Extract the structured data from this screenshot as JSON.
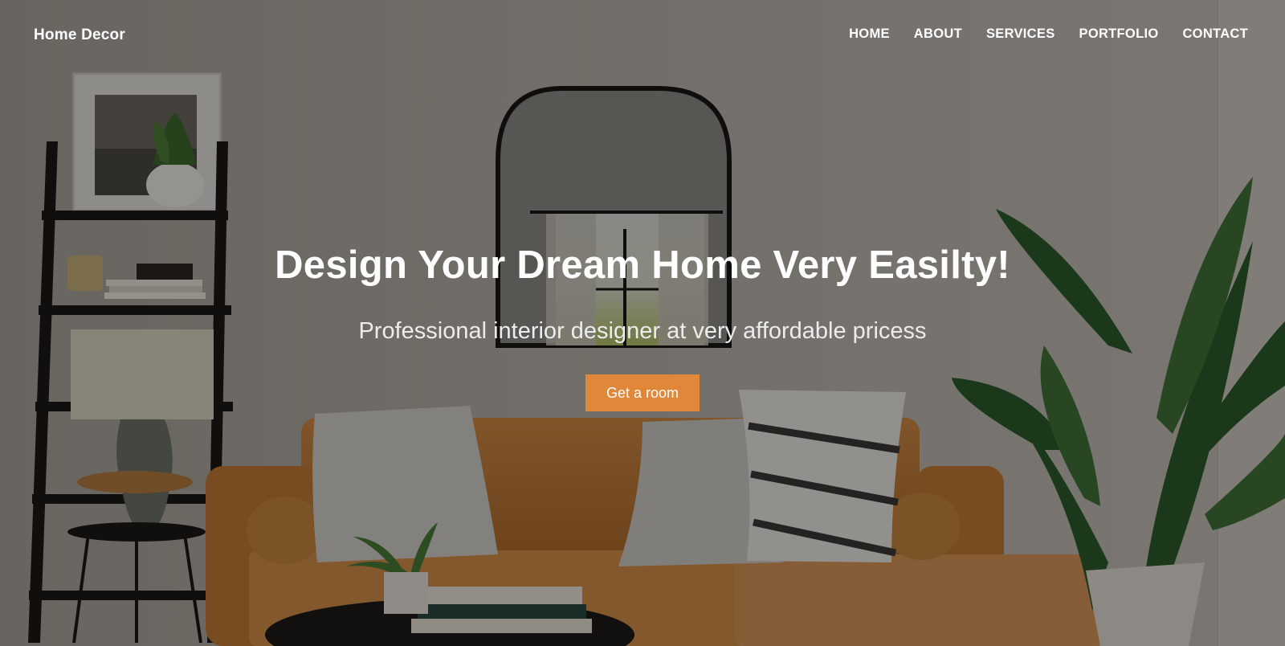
{
  "brand": {
    "name": "Home Decor"
  },
  "nav": {
    "items": [
      {
        "label": "HOME"
      },
      {
        "label": "ABOUT"
      },
      {
        "label": "SERVICES"
      },
      {
        "label": "PORTFOLIO"
      },
      {
        "label": "CONTACT"
      }
    ]
  },
  "hero": {
    "title": "Design Your Dream Home Very Easilty!",
    "subtitle": "Professional interior designer at very affordable pricess",
    "cta_label": "Get a room"
  },
  "colors": {
    "accent": "#e1873a",
    "overlay": "rgba(0,0,0,0.38)",
    "text": "#ffffff"
  }
}
